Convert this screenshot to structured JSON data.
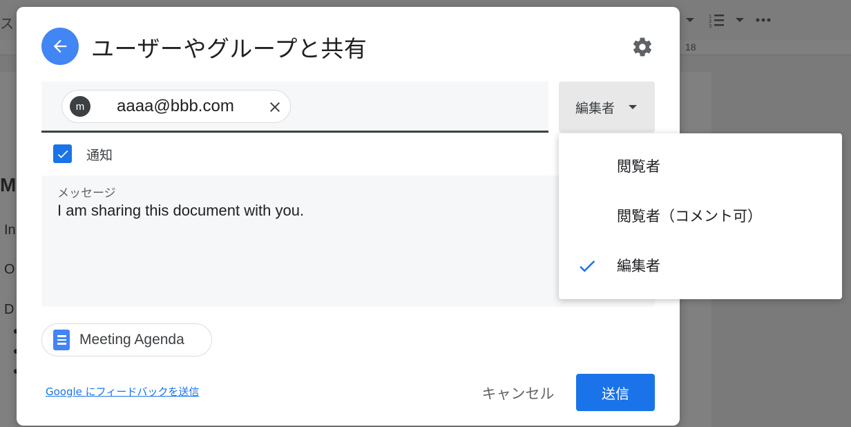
{
  "background": {
    "ruler_number": "18",
    "heading_fragment": "Me",
    "lines": [
      "In",
      "O",
      "D"
    ],
    "toolbar_left_fragment": "ス"
  },
  "dialog": {
    "title": "ユーザーやグループと共有",
    "recipient": {
      "avatar_letter": "m",
      "email": "aaaa@bbb.com"
    },
    "role_selected": "編集者",
    "notify": {
      "label": "通知",
      "checked": true
    },
    "message": {
      "label": "メッセージ",
      "text": "I am sharing this document with you."
    },
    "document_chip": "Meeting Agenda",
    "feedback_link": "Google にフィードバックを送信",
    "cancel_label": "キャンセル",
    "send_label": "送信"
  },
  "role_menu": {
    "items": [
      {
        "label": "閲覧者",
        "selected": false
      },
      {
        "label": "閲覧者（コメント可）",
        "selected": false
      },
      {
        "label": "編集者",
        "selected": true
      }
    ]
  },
  "colors": {
    "accent": "#1a73e8",
    "back_button": "#4285f4",
    "overlay": "#7a7a7a"
  }
}
